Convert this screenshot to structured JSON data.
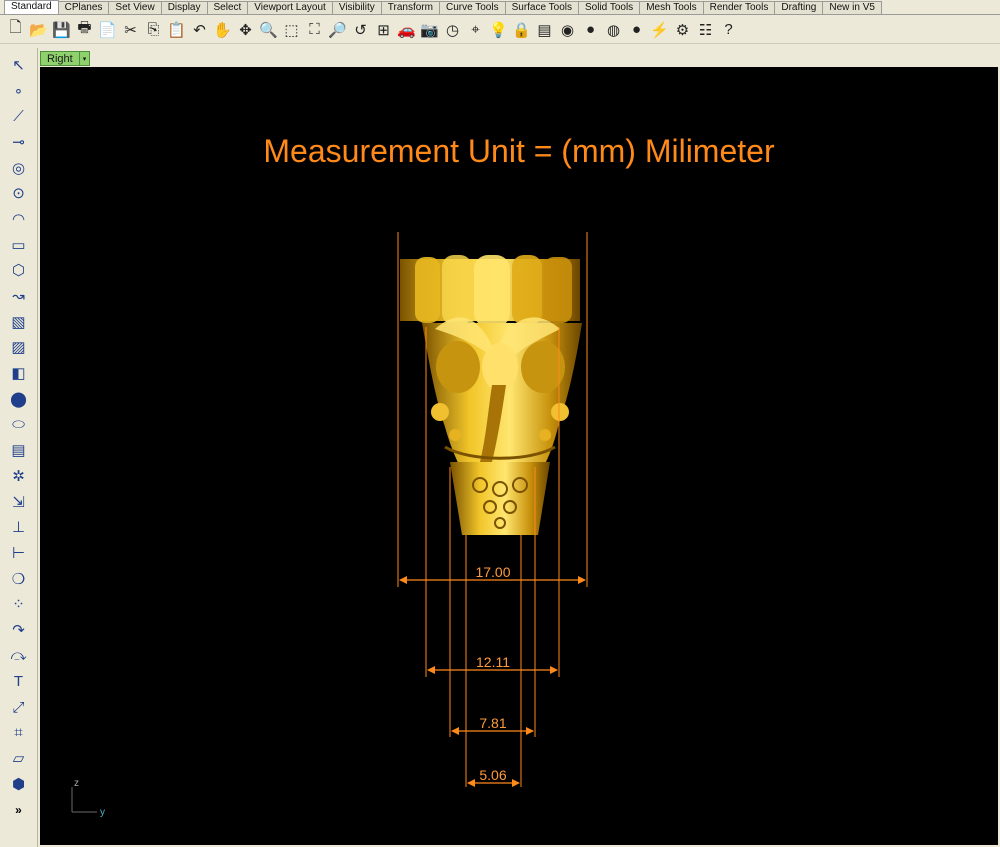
{
  "tabs": [
    {
      "label": "Standard"
    },
    {
      "label": "CPlanes"
    },
    {
      "label": "Set View"
    },
    {
      "label": "Display"
    },
    {
      "label": "Select"
    },
    {
      "label": "Viewport Layout"
    },
    {
      "label": "Visibility"
    },
    {
      "label": "Transform"
    },
    {
      "label": "Curve Tools"
    },
    {
      "label": "Surface Tools"
    },
    {
      "label": "Solid Tools"
    },
    {
      "label": "Mesh Tools"
    },
    {
      "label": "Render Tools"
    },
    {
      "label": "Drafting"
    },
    {
      "label": "New in V5"
    }
  ],
  "toolbar": {
    "icons": [
      "new-file-icon",
      "open-folder-icon",
      "save-icon",
      "print-icon",
      "import-icon",
      "cut-icon",
      "copy-icon",
      "paste-icon",
      "undo-icon",
      "pan-hand-icon",
      "rotate-view-icon",
      "zoom-icon",
      "zoom-window-icon",
      "zoom-extents-icon",
      "zoom-selected-icon",
      "undo-view-icon",
      "four-viewports-icon",
      "car-icon",
      "camera-icon",
      "clock-icon",
      "snap-icon",
      "light-bulb-icon",
      "lock-icon",
      "layers-icon",
      "color-wheel-icon",
      "shaded-sphere-icon",
      "rendered-sphere-icon",
      "blue-sphere-icon",
      "flashlight-icon",
      "options-gear-icon",
      "properties-icon",
      "help-icon"
    ],
    "glyphs": [
      "🗋",
      "📂",
      "💾",
      "🖶",
      "📄",
      "✂",
      "⎘",
      "📋",
      "↶",
      "✋",
      "✥",
      "🔍",
      "⬚",
      "⛶",
      "🔎",
      "↺",
      "⊞",
      "🚗",
      "📷",
      "◷",
      "⌖",
      "💡",
      "🔒",
      "▤",
      "◉",
      "●",
      "◍",
      "●",
      "⚡",
      "⚙",
      "☷",
      "?"
    ]
  },
  "sidebar": {
    "icons": [
      "select-arrow-icon",
      "point-icon",
      "polyline-icon",
      "line-icon",
      "circle-icon",
      "ellipse-icon",
      "arc-icon",
      "rectangle-icon",
      "polygon-icon",
      "curve-icon",
      "surface-icon",
      "extrude-icon",
      "box-icon",
      "boolean-icon",
      "cylinder-icon",
      "surface-patch-icon",
      "gear-icon",
      "transform-icon",
      "align-icon",
      "snap-icon",
      "shade-icon",
      "points-icon",
      "fillet-icon",
      "chamfer-icon",
      "text-icon",
      "scale-icon",
      "group-icon",
      "edit-icon",
      "object-box-icon",
      "more-icon"
    ],
    "glyphs": [
      "↖",
      "∘",
      "⟋",
      "⊸",
      "◎",
      "⊙",
      "◠",
      "▭",
      "⬡",
      "↝",
      "▧",
      "▨",
      "◧",
      "⬤",
      "⬭",
      "▤",
      "✲",
      "⇲",
      "⊥",
      "⊢",
      "❍",
      "⁘",
      "↷",
      "⤼",
      "T",
      "⤢",
      "⌗",
      "▱",
      "⬢",
      "»"
    ]
  },
  "viewport": {
    "name": "Right",
    "dropdown_arrow": "▾",
    "headline": "Measurement Unit = (mm) Milimeter",
    "axis_z": "z",
    "axis_y": "y",
    "dimensions": [
      {
        "label": "17.00",
        "value": 17.0
      },
      {
        "label": "12.11",
        "value": 12.11
      },
      {
        "label": "7.81",
        "value": 7.81
      },
      {
        "label": "5.06",
        "value": 5.06
      }
    ],
    "accent_color": "#ff8a1a",
    "model_color": "#d4a414"
  }
}
